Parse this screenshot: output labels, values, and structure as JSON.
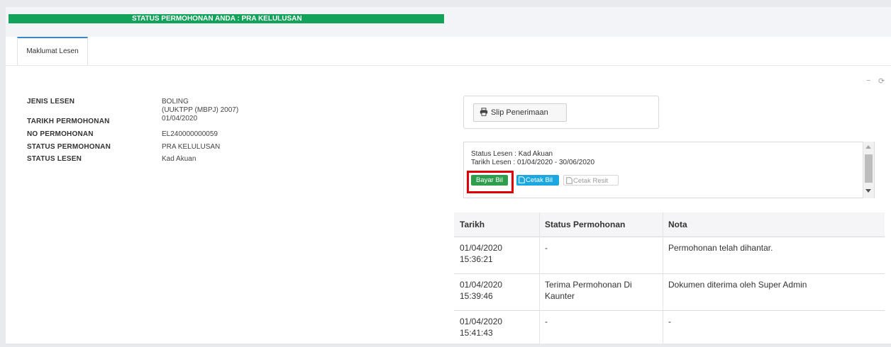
{
  "status_banner": "STATUS PERMOHONAN ANDA : PRA KELULUSAN",
  "tab_label": "Maklumat Lesen",
  "panel_tools": {
    "minimize": "−",
    "refresh": "⟳"
  },
  "licence_info": {
    "jenis_lesen_label": "JENIS LESEN",
    "jenis_lesen_value_1": "BOLING",
    "jenis_lesen_value_2": "(UUKTPP (MBPJ) 2007)",
    "tarikh_permohonan_label": "TARIKH PERMOHONAN",
    "tarikh_permohonan_value": "01/04/2020",
    "no_permohonan_label": "NO PERMOHONAN",
    "no_permohonan_value": "EL240000000059",
    "status_permohonan_label": "STATUS PERMOHONAN",
    "status_permohonan_value": "PRA KELULUSAN",
    "status_lesen_label": "STATUS LESEN",
    "status_lesen_value": "Kad Akuan"
  },
  "slip_button": "Slip Penerimaan",
  "licence_box": {
    "status_line": "Status Lesen : Kad Akuan",
    "date_line": "Tarikh Lesen : 01/04/2020 - 30/06/2020",
    "bayar_bil": "Bayar Bil",
    "cetak_bil": "Cetak Bil",
    "cetak_resit": "Cetak Resit"
  },
  "history_table": {
    "headers": [
      "Tarikh",
      "Status Permohonan",
      "Nota"
    ],
    "rows": [
      {
        "date": "01/04/2020",
        "time": "15:36:21",
        "status_1": "-",
        "status_2": "",
        "nota": "Permohonan telah dihantar."
      },
      {
        "date": "01/04/2020",
        "time": "15:39:46",
        "status_1": "Terima Permohonan Di",
        "status_2": "Kaunter",
        "nota": "Dokumen diterima oleh Super Admin"
      },
      {
        "date": "01/04/2020",
        "time": "15:41:43",
        "status_1": "-",
        "status_2": "",
        "nota": "-"
      }
    ]
  },
  "colors": {
    "banner_green": "#12a25a",
    "pay_green": "#2e9e4d",
    "print_blue": "#1ba8e0",
    "highlight_red": "#e00000",
    "tab_accent": "#3a87c7"
  }
}
